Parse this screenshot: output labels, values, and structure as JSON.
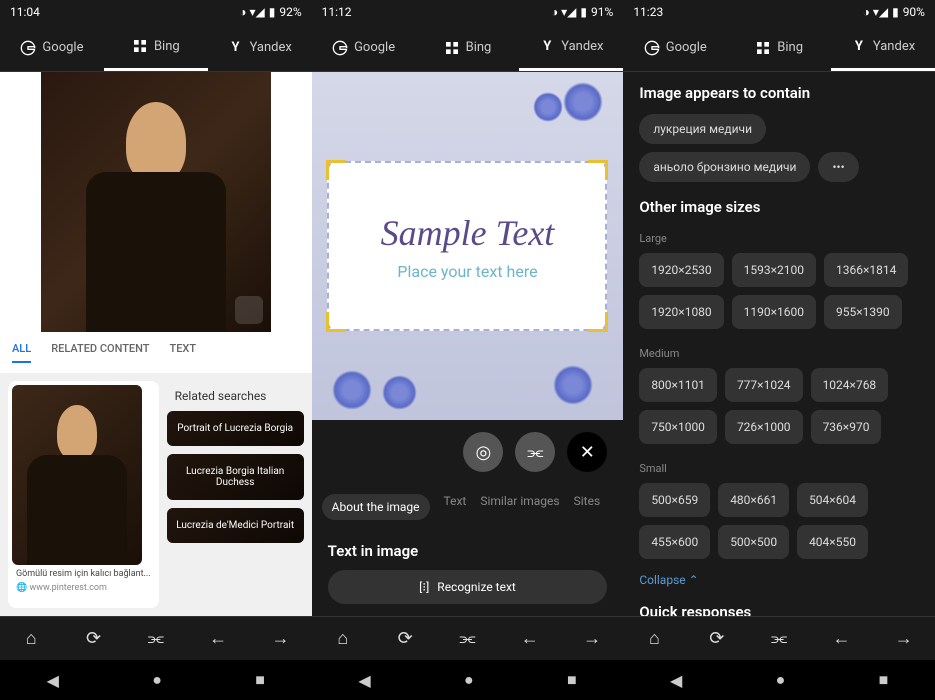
{
  "panel1": {
    "status": {
      "time": "11:04",
      "battery": "92%"
    },
    "tabs": [
      {
        "label": "Google",
        "active": false
      },
      {
        "label": "Bing",
        "active": true
      },
      {
        "label": "Yandex",
        "active": false
      }
    ],
    "subtabs": {
      "all": "ALL",
      "related": "RELATED CONTENT",
      "text": "TEXT"
    },
    "result": {
      "caption": "Gömülü resim için kalıcı bağlant...",
      "source": "www.pinterest.com"
    },
    "related": {
      "title": "Related searches",
      "chips": [
        "Portrait of Lucrezia Borgia",
        "Lucrezia Borgia Italian Duchess",
        "Lucrezia de'Medici Portrait"
      ]
    }
  },
  "panel2": {
    "status": {
      "time": "11:12",
      "battery": "91%"
    },
    "tabs": [
      {
        "label": "Google",
        "active": false
      },
      {
        "label": "Bing",
        "active": false
      },
      {
        "label": "Yandex",
        "active": true
      }
    ],
    "sample": {
      "title": "Sample Text",
      "subtitle": "Place your text here"
    },
    "catTabs": {
      "about": "About the image",
      "text": "Text",
      "similar": "Similar images",
      "sites": "Sites"
    },
    "section": {
      "title": "Text in image",
      "recognize": "Recognize text"
    }
  },
  "panel3": {
    "status": {
      "time": "11:23",
      "battery": "90%"
    },
    "tabs": [
      {
        "label": "Google",
        "active": false
      },
      {
        "label": "Bing",
        "active": false
      },
      {
        "label": "Yandex",
        "active": true
      }
    ],
    "contains": {
      "title": "Image appears to contain",
      "chips": [
        "лукреция медичи",
        "аньоло бронзино медичи"
      ]
    },
    "sizes": {
      "title": "Other image sizes",
      "groups": [
        {
          "label": "Large",
          "items": [
            "1920×2530",
            "1593×2100",
            "1366×1814",
            "1920×1080",
            "1190×1600",
            "955×1390"
          ]
        },
        {
          "label": "Medium",
          "items": [
            "800×1101",
            "777×1024",
            "1024×768",
            "750×1000",
            "726×1000",
            "736×970"
          ]
        },
        {
          "label": "Small",
          "items": [
            "500×659",
            "480×661",
            "504×604",
            "455×600",
            "500×500",
            "404×550"
          ]
        }
      ],
      "collapse": "Collapse"
    },
    "quick": {
      "title": "Quick responses"
    }
  }
}
